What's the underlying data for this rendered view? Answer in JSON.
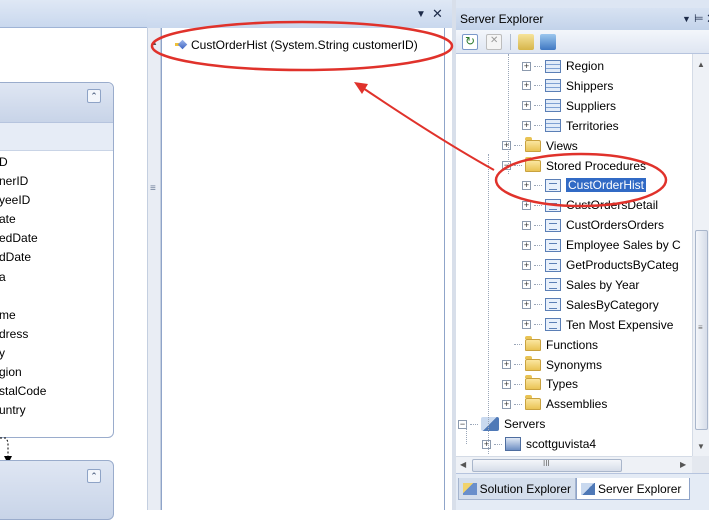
{
  "designer": {
    "fields": [
      "D",
      "nerID",
      "yeeID",
      "ate",
      "edDate",
      "dDate",
      "a",
      "",
      "me",
      "dress",
      "y",
      "gion",
      "stalCode",
      "untry"
    ],
    "collapse_icon": "chevron-double-up-icon"
  },
  "methods_pane": {
    "header_pin": "▼",
    "header_close": "✕",
    "method_label": "CustOrderHist (System.String customerID)"
  },
  "server_explorer": {
    "title": "Server Explorer",
    "title_dropdown": "▼",
    "title_pin": "ᵖ",
    "title_close": "✕",
    "tree": [
      {
        "label": "Region",
        "icon": "table-icon",
        "expander": "+"
      },
      {
        "label": "Shippers",
        "icon": "table-icon",
        "expander": "+"
      },
      {
        "label": "Suppliers",
        "icon": "table-icon",
        "expander": "+"
      },
      {
        "label": "Territories",
        "icon": "table-icon",
        "expander": "+"
      },
      {
        "label": "Views",
        "icon": "folder-icon",
        "expander": "+"
      },
      {
        "label": "Stored Procedures",
        "icon": "folder-icon",
        "expander": "−"
      },
      {
        "label": "CustOrderHist",
        "icon": "stored-procedure-icon",
        "expander": "+",
        "selected": true
      },
      {
        "label": "CustOrdersDetail",
        "icon": "stored-procedure-icon",
        "expander": "+"
      },
      {
        "label": "CustOrdersOrders",
        "icon": "stored-procedure-icon",
        "expander": "+"
      },
      {
        "label": "Employee Sales by C",
        "icon": "stored-procedure-icon",
        "expander": "+"
      },
      {
        "label": "GetProductsByCateg",
        "icon": "stored-procedure-icon",
        "expander": "+"
      },
      {
        "label": "Sales by Year",
        "icon": "stored-procedure-icon",
        "expander": "+"
      },
      {
        "label": "SalesByCategory",
        "icon": "stored-procedure-icon",
        "expander": "+"
      },
      {
        "label": "Ten Most Expensive",
        "icon": "stored-procedure-icon",
        "expander": "+"
      },
      {
        "label": "Functions",
        "icon": "folder-icon",
        "expander": ""
      },
      {
        "label": "Synonyms",
        "icon": "folder-icon",
        "expander": "+"
      },
      {
        "label": "Types",
        "icon": "folder-icon",
        "expander": "+"
      },
      {
        "label": "Assemblies",
        "icon": "folder-icon",
        "expander": "+"
      },
      {
        "label": "Servers",
        "icon": "servers-icon",
        "expander": "−"
      },
      {
        "label": "scottguvista4",
        "icon": "server-icon",
        "expander": "+"
      }
    ],
    "hscroll_grip": "III",
    "vscroll_grip": "≡",
    "tabs": [
      {
        "label": "Solution Explorer"
      },
      {
        "label": "Server Explorer"
      }
    ]
  },
  "colors": {
    "annotation": "#e0322b",
    "selection": "#316ac5"
  }
}
